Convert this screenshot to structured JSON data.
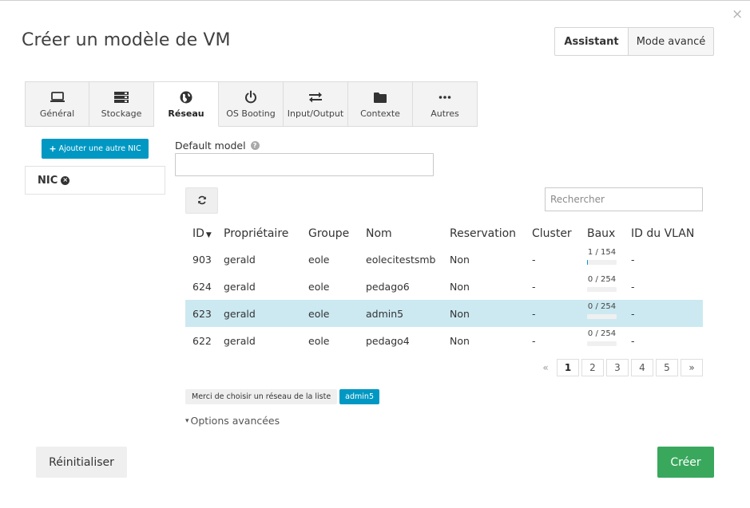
{
  "dialog": {
    "title": "Créer un modèle de VM",
    "close_glyph": "×",
    "modes": [
      {
        "label": "Assistant",
        "active": true
      },
      {
        "label": "Mode avancé",
        "active": false
      }
    ]
  },
  "tabs": [
    {
      "label": "Général",
      "icon": "laptop-icon",
      "active": false
    },
    {
      "label": "Stockage",
      "icon": "storage-icon",
      "active": false
    },
    {
      "label": "Réseau",
      "icon": "globe-icon",
      "active": true
    },
    {
      "label": "OS Booting",
      "icon": "power-icon",
      "active": false
    },
    {
      "label": "Input/Output",
      "icon": "exchange-icon",
      "active": false
    },
    {
      "label": "Contexte",
      "icon": "folder-icon",
      "active": false
    },
    {
      "label": "Autres",
      "icon": "ellipsis-icon",
      "active": false
    }
  ],
  "nic": {
    "add_label": "Ajouter une autre NIC",
    "add_glyph": "+",
    "item_label": "NIC",
    "remove_glyph": "×"
  },
  "network": {
    "default_model_label": "Default model",
    "help_glyph": "?",
    "default_model_value": "",
    "search_placeholder": "Rechercher",
    "sort_caret": "▼",
    "columns": [
      "ID",
      "Propriétaire",
      "Groupe",
      "Nom",
      "Reservation",
      "Cluster",
      "Baux",
      "ID du VLAN"
    ],
    "rows": [
      {
        "id": "903",
        "owner": "gerald",
        "group": "eole",
        "name": "eolecitestsmb",
        "reservation": "Non",
        "cluster": "-",
        "leases": "1 / 154",
        "leases_fraction": 0.0065,
        "vlan": "-",
        "selected": false
      },
      {
        "id": "624",
        "owner": "gerald",
        "group": "eole",
        "name": "pedago6",
        "reservation": "Non",
        "cluster": "-",
        "leases": "0 / 254",
        "leases_fraction": 0,
        "vlan": "-",
        "selected": false
      },
      {
        "id": "623",
        "owner": "gerald",
        "group": "eole",
        "name": "admin5",
        "reservation": "Non",
        "cluster": "-",
        "leases": "0 / 254",
        "leases_fraction": 0,
        "vlan": "-",
        "selected": true
      },
      {
        "id": "622",
        "owner": "gerald",
        "group": "eole",
        "name": "pedago4",
        "reservation": "Non",
        "cluster": "-",
        "leases": "0 / 254",
        "leases_fraction": 0,
        "vlan": "-",
        "selected": false
      }
    ],
    "pagination": {
      "prev": "«",
      "pages": [
        "1",
        "2",
        "3",
        "4",
        "5"
      ],
      "current": "1",
      "next": "»"
    },
    "selection_message": "Merci de choisir un réseau de la liste",
    "selected_value": "admin5",
    "advanced_options_label": "Options avancées",
    "advanced_caret": "▾"
  },
  "footer": {
    "reset_label": "Réinitialiser",
    "create_label": "Créer"
  },
  "colors": {
    "accent": "#0098c3",
    "create": "#39a85d",
    "selected_row": "#cce9f1"
  }
}
